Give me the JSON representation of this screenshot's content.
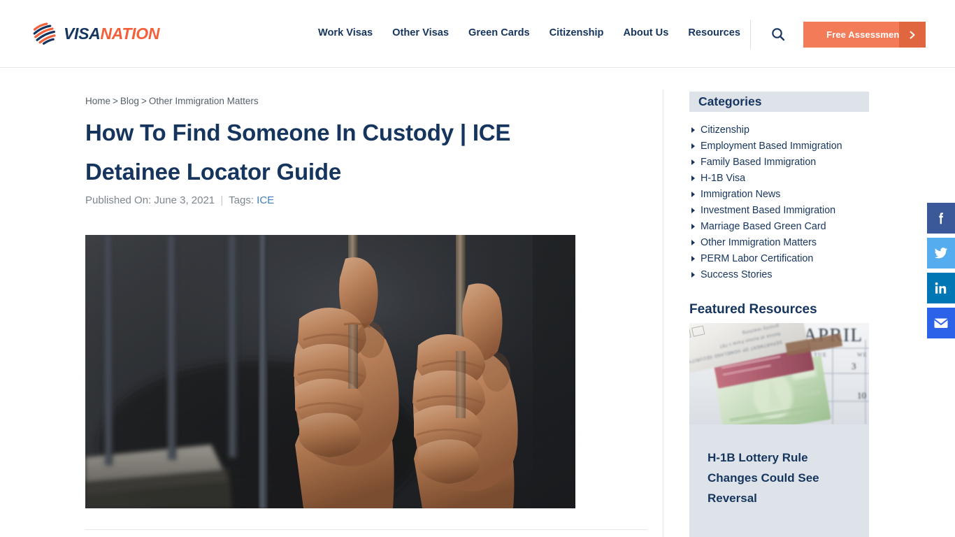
{
  "header": {
    "logo": {
      "part1": "VISA",
      "part2": "NATION",
      "icon": "globe-stripes-icon"
    },
    "nav": [
      {
        "label": "Work Visas"
      },
      {
        "label": "Other Visas"
      },
      {
        "label": "Green Cards"
      },
      {
        "label": "Citizenship"
      },
      {
        "label": "About Us"
      },
      {
        "label": "Resources"
      }
    ],
    "search_icon": "search-icon",
    "cta": {
      "label": "Free Assessment",
      "arrow": "chevron-right-icon"
    },
    "colors": {
      "navy": "#16355e",
      "orange": "#f2603c",
      "cta_bg": "#f47b58",
      "cta_arrow_bg": "#e0663f"
    }
  },
  "breadcrumb": {
    "home": "Home",
    "sep": ">",
    "blog": "Blog",
    "current": "Other Immigration Matters"
  },
  "article": {
    "title": "How To Find Someone In Custody | ICE Detainee Locator Guide",
    "published_label": "Published On:",
    "published_date": "June 3, 2021",
    "meta_divider": "|",
    "tags_label": "Tags:",
    "tag": "ICE",
    "hero_alt": "hands-gripping-prison-bars-image"
  },
  "sidebar": {
    "categories_title": "Categories",
    "categories": [
      {
        "label": "Citizenship"
      },
      {
        "label": "Employment Based Immigration"
      },
      {
        "label": "Family Based Immigration"
      },
      {
        "label": "H-1B Visa"
      },
      {
        "label": "Immigration News"
      },
      {
        "label": "Investment Based Immigration"
      },
      {
        "label": "Marriage Based Green Card"
      },
      {
        "label": "Other Immigration Matters"
      },
      {
        "label": "PERM Labor Certification"
      },
      {
        "label": "Success Stories"
      }
    ],
    "featured_title": "Featured Resources",
    "featured_card": {
      "title": "H-1B Lottery Rule Changes Could See Reversal",
      "image_alt": "immigration-documents-on-april-calendar-image",
      "image_text": "APRIL"
    }
  },
  "social": [
    {
      "name": "facebook",
      "color": "#3b5998"
    },
    {
      "name": "twitter",
      "color": "#55acee"
    },
    {
      "name": "linkedin",
      "color": "#0077b5"
    },
    {
      "name": "email",
      "color": "#2b62e8"
    }
  ]
}
